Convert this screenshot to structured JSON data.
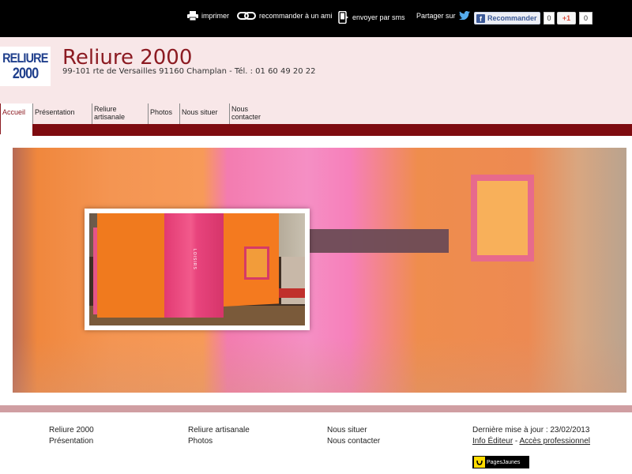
{
  "toolbar": {
    "print_label": "imprimer",
    "recommend_label": "recommander à un ami",
    "sms_label": "envoyer par sms",
    "share_label": "Partager sur",
    "fb_label": "Recommander",
    "fb_count": "0",
    "gplus_label": "+1",
    "gplus_count": "0"
  },
  "header": {
    "logo_line1": "RELIURE",
    "logo_line2": "2000",
    "title": "Reliure 2000",
    "subtitle": "99-101 rte de Versailles 91160 Champlan - Tél. : 01 60 49 20 22"
  },
  "nav": {
    "items": [
      {
        "label": "Accueil"
      },
      {
        "label": "Présentation"
      },
      {
        "label": "Reliure artisanale"
      },
      {
        "label": "Photos"
      },
      {
        "label": "Nous situer"
      },
      {
        "label": "Nous contacter"
      }
    ],
    "active": "Accueil"
  },
  "hero": {
    "spine_text": "LOISIRS"
  },
  "footer": {
    "col1": [
      "Reliure 2000",
      "Présentation"
    ],
    "col2": [
      "Reliure artisanale",
      "Photos"
    ],
    "col3": [
      "Nous situer",
      "Nous contacter"
    ],
    "updated": "Dernière mise à jour : 23/02/2013",
    "info_editeur": "Info Éditeur",
    "separator": " - ",
    "acces_pro": "Accès professionnel",
    "pagesjaunes": "PagesJaunes"
  },
  "colors": {
    "brand_red": "#8c1b22",
    "nav_bar": "#7e0b10",
    "header_bg": "#f8e7e8",
    "footer_strip": "#d09ea2"
  }
}
